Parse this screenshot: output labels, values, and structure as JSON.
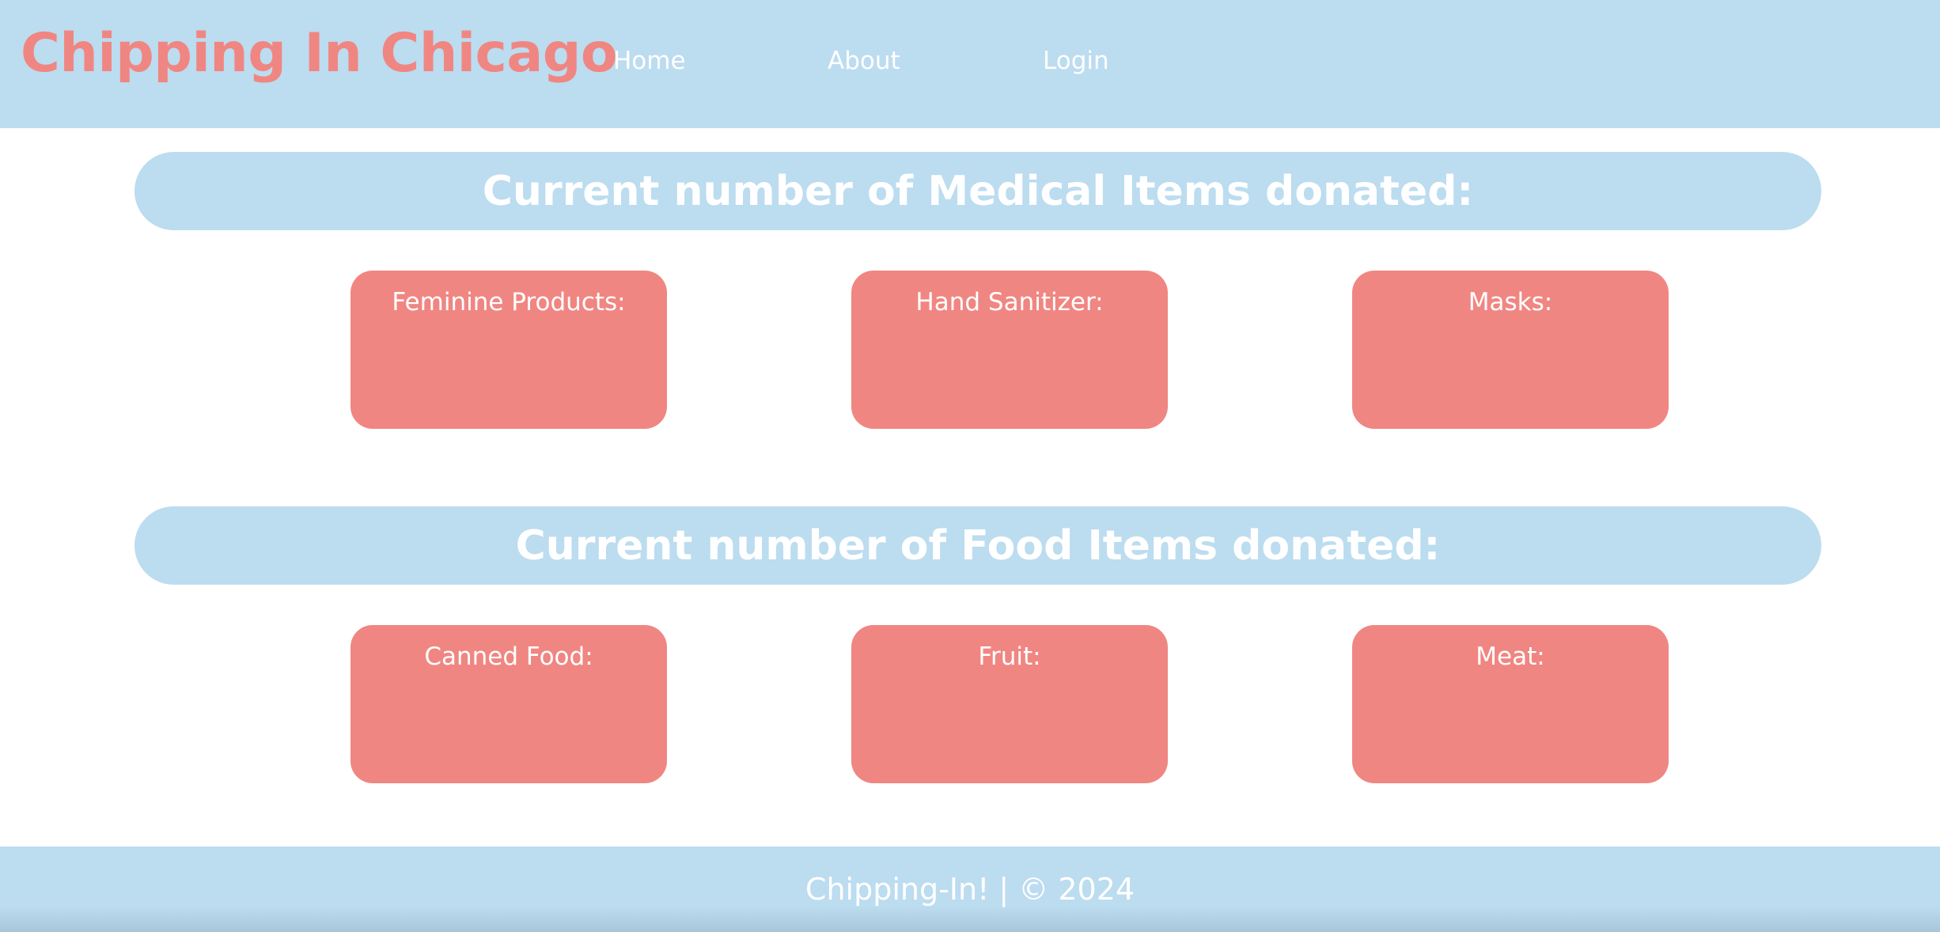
{
  "header": {
    "brand": "Chipping In Chicago",
    "nav": {
      "home": "Home",
      "about": "About",
      "login": "Login"
    }
  },
  "medical": {
    "heading": "Current number of Medical Items donated:",
    "items": [
      {
        "label": "Feminine Products:"
      },
      {
        "label": "Hand Sanitizer:"
      },
      {
        "label": "Masks:"
      }
    ]
  },
  "food": {
    "heading": "Current number of Food Items donated:",
    "items": [
      {
        "label": "Canned Food:"
      },
      {
        "label": "Fruit:"
      },
      {
        "label": "Meat:"
      }
    ]
  },
  "footer": {
    "text": "Chipping-In! | © 2024"
  },
  "colors": {
    "header_bg": "#bcdcf0",
    "accent": "#f08682",
    "text_light": "#ffffff"
  }
}
